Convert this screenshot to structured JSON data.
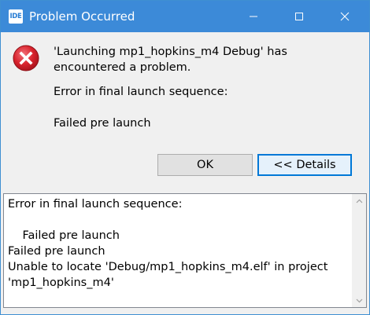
{
  "window": {
    "app_icon_text": "IDE",
    "title": "Problem Occurred",
    "icons": {
      "app": "ide-icon",
      "minimize": "minimize-icon",
      "maximize": "maximize-icon",
      "close": "close-icon",
      "error": "error-icon"
    }
  },
  "dialog": {
    "message": "'Launching mp1_hopkins_m4 Debug' has encountered a problem.",
    "detail_heading": "Error in final launch sequence:",
    "detail_reason": "Failed pre launch",
    "ok_label": "OK",
    "details_label": "<< Details"
  },
  "details": {
    "text": "Error in final launch sequence:\n\n    Failed pre launch\nFailed pre launch\nUnable to locate 'Debug/mp1_hopkins_m4.elf' in project 'mp1_hopkins_m4'"
  },
  "colors": {
    "titlebar": "#3c8ad8",
    "error_red": "#d9232d",
    "button_focus": "#0078d7"
  }
}
